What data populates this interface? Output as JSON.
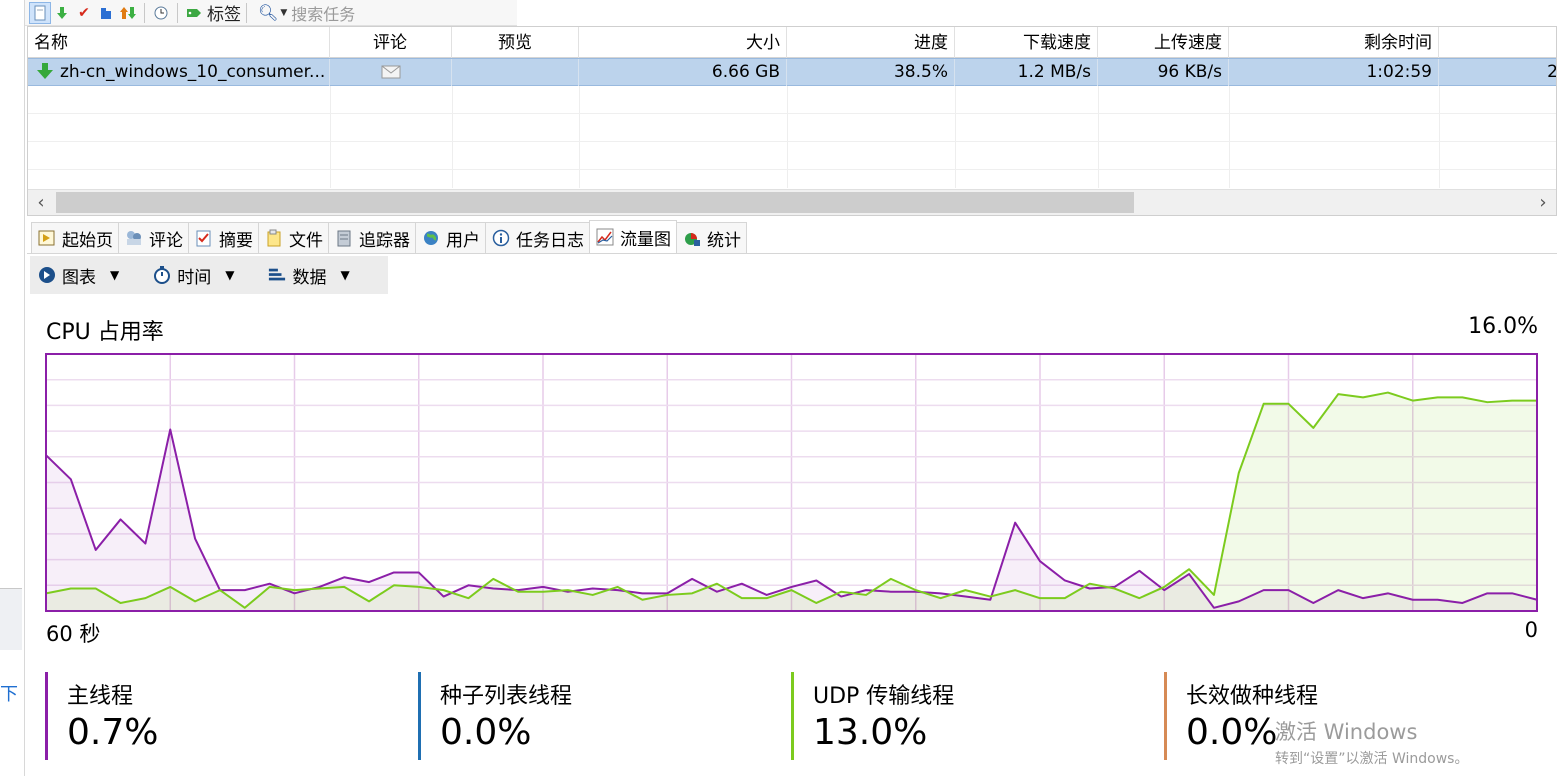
{
  "toolbar": {
    "tag_label": "标签",
    "search_placeholder": "搜索任务"
  },
  "list": {
    "columns": [
      "名称",
      "评论",
      "预览",
      "大小",
      "进度",
      "下载速度",
      "上传速度",
      "剩余时间"
    ],
    "rows": [
      {
        "name": "zh-cn_windows_10_consumer...",
        "size": "6.66 GB",
        "progress": "38.5%",
        "down_speed": "1.2 MB/s",
        "up_speed": "96 KB/s",
        "remaining": "1:02:59",
        "extra": "2"
      }
    ]
  },
  "tabs": [
    "起始页",
    "评论",
    "摘要",
    "文件",
    "追踪器",
    "用户",
    "任务日志",
    "流量图",
    "统计"
  ],
  "active_tab": "流量图",
  "subbar": {
    "chart_label": "图表",
    "time_label": "时间",
    "data_label": "数据"
  },
  "chart_data": {
    "type": "area",
    "title": "CPU 占用率",
    "max_label": "16.0%",
    "x_left_label": "60 秒",
    "x_right_label": "0",
    "ylim": [
      0,
      16
    ],
    "x": [
      60,
      59,
      58,
      57,
      56,
      55,
      54,
      53,
      52,
      51,
      50,
      49,
      48,
      47,
      46,
      45,
      44,
      43,
      42,
      41,
      40,
      39,
      38,
      37,
      36,
      35,
      34,
      33,
      32,
      31,
      30,
      29,
      28,
      27,
      26,
      25,
      24,
      23,
      22,
      21,
      20,
      19,
      18,
      17,
      16,
      15,
      14,
      13,
      12,
      11,
      10,
      9,
      8,
      7,
      6,
      5,
      4,
      3,
      2,
      1,
      0
    ],
    "series": [
      {
        "name": "主线程",
        "color": "#8b1fa8",
        "values": [
          9.7,
          8.2,
          3.8,
          5.7,
          4.2,
          11.3,
          4.5,
          1.3,
          1.3,
          1.7,
          1.1,
          1.5,
          2.1,
          1.8,
          2.4,
          2.4,
          0.9,
          1.6,
          1.4,
          1.3,
          1.5,
          1.2,
          1.4,
          1.3,
          1.1,
          1.1,
          2.0,
          1.2,
          1.7,
          1.0,
          1.5,
          1.9,
          0.9,
          1.3,
          1.2,
          1.2,
          1.1,
          0.9,
          0.7,
          5.5,
          3.1,
          1.9,
          1.4,
          1.5,
          2.5,
          1.3,
          2.3,
          0.2,
          0.6,
          1.3,
          1.3,
          0.5,
          1.3,
          0.8,
          1.1,
          0.7,
          0.7,
          0.5,
          1.1,
          1.1,
          0.7
        ]
      },
      {
        "name": "种子列表线程",
        "color": "#1f6fb2",
        "values": []
      },
      {
        "name": "UDP 传输线程",
        "color": "#7ccb1e",
        "values": [
          1.1,
          1.4,
          1.4,
          0.5,
          0.8,
          1.5,
          0.6,
          1.3,
          0.2,
          1.5,
          1.3,
          1.4,
          1.5,
          0.6,
          1.6,
          1.5,
          1.3,
          0.8,
          2.0,
          1.2,
          1.2,
          1.3,
          1.0,
          1.5,
          0.7,
          1.0,
          1.1,
          1.7,
          0.8,
          0.8,
          1.3,
          0.5,
          1.2,
          1.0,
          2.0,
          1.3,
          0.8,
          1.3,
          0.9,
          1.3,
          0.8,
          0.8,
          1.7,
          1.4,
          0.8,
          1.5,
          2.6,
          1.0,
          8.6,
          12.9,
          12.9,
          11.4,
          13.5,
          13.3,
          13.6,
          13.1,
          13.3,
          13.3,
          13.0,
          13.1,
          13.1
        ]
      },
      {
        "name": "长效做种线程",
        "color": "#d68a55",
        "values": []
      }
    ]
  },
  "legend": [
    {
      "name": "主线程",
      "value": "0.7%",
      "color": "#8b1fa8"
    },
    {
      "name": "种子列表线程",
      "value": "0.0%",
      "color": "#1f6fb2"
    },
    {
      "name": "UDP 传输线程",
      "value": "13.0%",
      "color": "#7ccb1e"
    },
    {
      "name": "长效做种线程",
      "value": "0.0%",
      "color": "#d68a55"
    }
  ],
  "watermark": {
    "line1": "激活 Windows",
    "line2": "转到“设置”以激活 Windows。"
  },
  "left_strip_char": "下"
}
